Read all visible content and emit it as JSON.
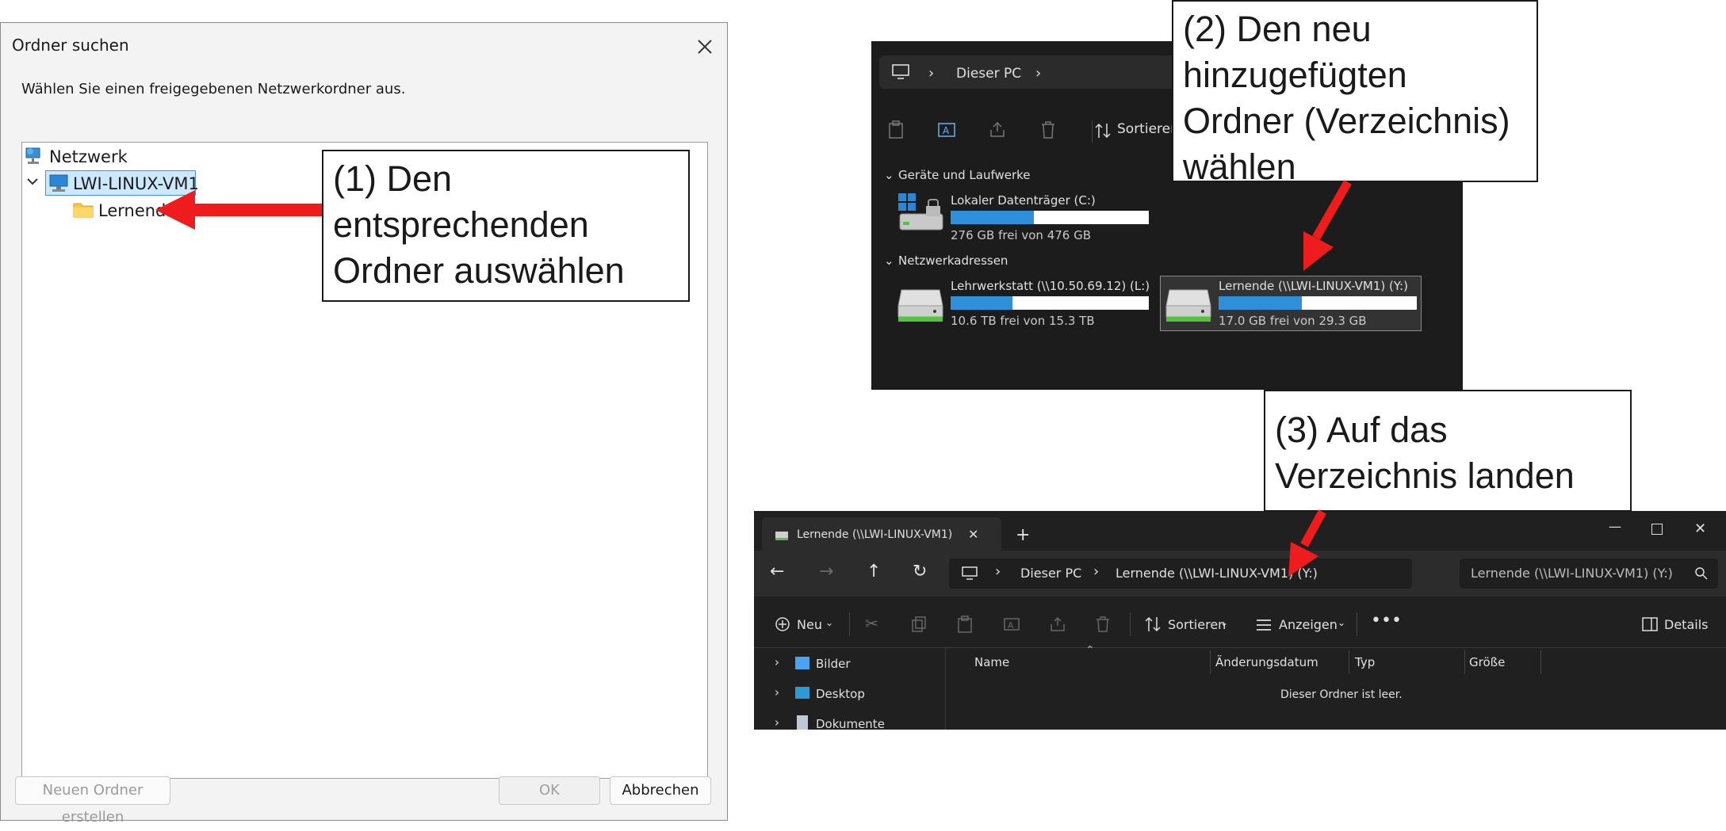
{
  "dialog": {
    "title": "Ordner suchen",
    "instruction": "Wählen Sie einen freigegebenen Netzwerkordner aus.",
    "tree": {
      "root": "Netzwerk",
      "computer": "LWI-LINUX-VM1",
      "folder": "Lernend"
    },
    "new_folder_button": "Neuen Ordner erstellen",
    "ok_button": "OK",
    "cancel_button": "Abbrechen"
  },
  "callouts": {
    "step1": [
      "(1) Den",
      "entsprechenden",
      "Ordner auswählen"
    ],
    "step2": [
      "(2) Den neu",
      "hinzugefügten",
      "Ordner (Verzeichnis)",
      "wählen"
    ],
    "step3": [
      "(3) Auf das",
      "Verzeichnis landen"
    ]
  },
  "explorer1": {
    "breadcrumb": "Dieser PC",
    "sort_label": "Sortieren",
    "section_drives": "Geräte und Laufwerke",
    "section_network": "Netzwerkadressen",
    "drives": [
      {
        "name": "Lokaler Datenträger (C:)",
        "free": "276 GB frei von 476 GB",
        "used_fraction": 0.42
      },
      {
        "name": "Lehrwerkstatt (\\\\10.50.69.12) (L:)",
        "free": "10.6 TB frei von 15.3 TB",
        "used_fraction": 0.31
      },
      {
        "name": "Lernende (\\\\LWI-LINUX-VM1) (Y:)",
        "free": "17.0 GB frei von 29.3 GB",
        "used_fraction": 0.42
      }
    ]
  },
  "explorer2": {
    "tab_title": "Lernende (\\\\LWI-LINUX-VM1)",
    "crumb_pc": "Dieser PC",
    "crumb_drive": "Lernende (\\\\LWI-LINUX-VM1) (Y:)",
    "search_placeholder": "Lernende (\\\\LWI-LINUX-VM1) (Y:)",
    "toolbar": {
      "new": "Neu",
      "sort": "Sortieren",
      "view": "Anzeigen",
      "details": "Details"
    },
    "sidebar": [
      "Bilder",
      "Desktop",
      "Dokumente"
    ],
    "columns": [
      "Name",
      "Änderungsdatum",
      "Typ",
      "Größe"
    ],
    "empty_message": "Dieser Ordner ist leer."
  },
  "colors": {
    "arrow": "#ee1c1c",
    "selection": "#cce8ff",
    "accent": "#2f8fd8"
  }
}
